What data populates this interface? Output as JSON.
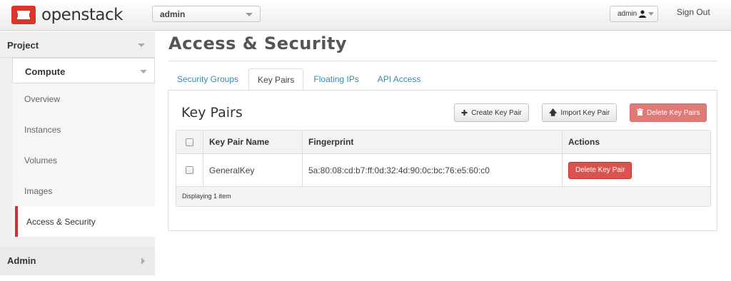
{
  "header": {
    "brand": "openstack",
    "project_select": "admin",
    "user_menu": "admin",
    "signout_label": "Sign Out"
  },
  "sidebar": {
    "project_label": "Project",
    "compute_label": "Compute",
    "items": [
      {
        "label": "Overview"
      },
      {
        "label": "Instances"
      },
      {
        "label": "Volumes"
      },
      {
        "label": "Images"
      },
      {
        "label": "Access & Security"
      }
    ],
    "admin_label": "Admin"
  },
  "main": {
    "page_title": "Access & Security",
    "tabs": [
      {
        "label": "Security Groups"
      },
      {
        "label": "Key Pairs"
      },
      {
        "label": "Floating IPs"
      },
      {
        "label": "API Access"
      }
    ],
    "active_tab": "Key Pairs",
    "panel_title": "Key Pairs",
    "buttons": {
      "create": "Create Key Pair",
      "import": "Import Key Pair",
      "delete_all": "Delete Key Pairs"
    },
    "table": {
      "columns": [
        "Key Pair Name",
        "Fingerprint",
        "Actions"
      ],
      "rows": [
        {
          "name": "GeneralKey",
          "fingerprint": "5a:80:08:cd:b7:ff:0d:32:4d:90:0c:bc:76:e5:60:c0",
          "action": "Delete Key Pair"
        }
      ],
      "footer": "Displaying 1 item"
    }
  },
  "colors": {
    "accent_red": "#cc3333",
    "danger": "#d9534f",
    "link": "#3a87ad"
  },
  "icons": {
    "brand_logo": "openstack-logo-icon",
    "user": "user-icon",
    "plus": "plus-icon",
    "upload": "arrow-up-icon",
    "trash": "trash-icon"
  }
}
